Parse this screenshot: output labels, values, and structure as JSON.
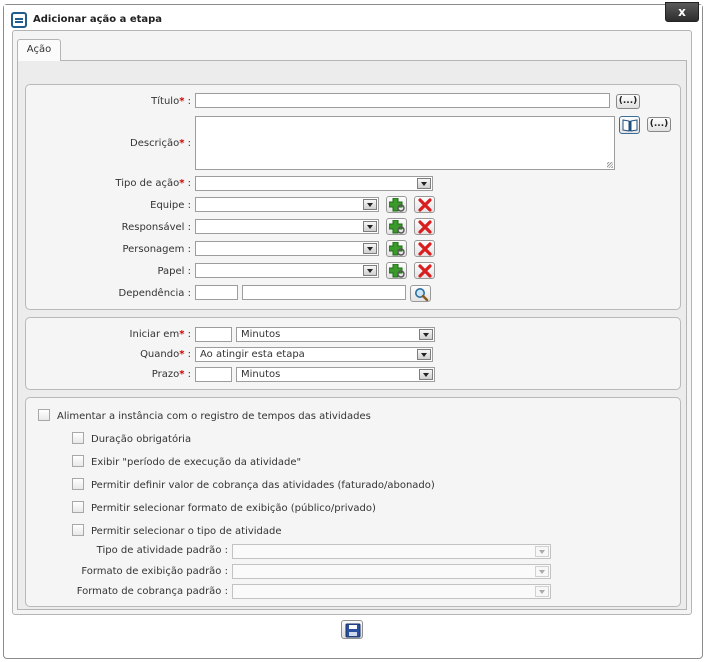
{
  "window": {
    "title": "Adicionar ação a etapa",
    "close_label": "x"
  },
  "tab": {
    "label": "Ação"
  },
  "form": {
    "titulo": {
      "label": "Título",
      "value": "",
      "button": "(...)"
    },
    "descricao": {
      "label": "Descrição",
      "value": "",
      "button": "(...)"
    },
    "tipo_acao": {
      "label": "Tipo de ação",
      "value": ""
    },
    "equipe": {
      "label": "Equipe",
      "value": ""
    },
    "responsavel": {
      "label": "Responsável",
      "value": ""
    },
    "personagem": {
      "label": "Personagem",
      "value": ""
    },
    "papel": {
      "label": "Papel",
      "value": ""
    },
    "dependencia": {
      "label": "Dependência",
      "value_code": "",
      "value_name": ""
    },
    "separator": ":",
    "required_mark": "*"
  },
  "timing": {
    "iniciar_em": {
      "label": "Iniciar em",
      "amount": "",
      "unit": "Minutos"
    },
    "quando": {
      "label": "Quando",
      "value": "Ao atingir esta etapa"
    },
    "prazo": {
      "label": "Prazo",
      "amount": "",
      "unit": "Minutos"
    }
  },
  "activities": {
    "main_checkbox": {
      "label": "Alimentar a instância com o registro de tempos das atividades",
      "checked": false
    },
    "options": [
      {
        "label": "Duração obrigatória",
        "checked": false
      },
      {
        "label": "Exibir \"período de execução da atividade\"",
        "checked": false
      },
      {
        "label": "Permitir definir valor de cobrança das atividades (faturado/abonado)",
        "checked": false
      },
      {
        "label": "Permitir selecionar formato de exibição (público/privado)",
        "checked": false
      },
      {
        "label": "Permitir selecionar o tipo de atividade",
        "checked": false
      }
    ],
    "tipo_padrao": {
      "label": "Tipo de atividade padrão",
      "value": ""
    },
    "formato_exibicao_padrao": {
      "label": "Formato de exibição padrão",
      "value": ""
    },
    "formato_cobranca_padrao": {
      "label": "Formato de cobrança padrão",
      "value": ""
    }
  },
  "colors": {
    "required": "#d40000",
    "panel": "#f5f5f5",
    "border": "#b9b9b9",
    "add": "#3a9a2a",
    "remove": "#d81e1e"
  },
  "icons": {
    "add": "add-icon",
    "remove": "remove-icon",
    "search": "search-icon",
    "book": "book-icon",
    "save": "save-icon"
  }
}
